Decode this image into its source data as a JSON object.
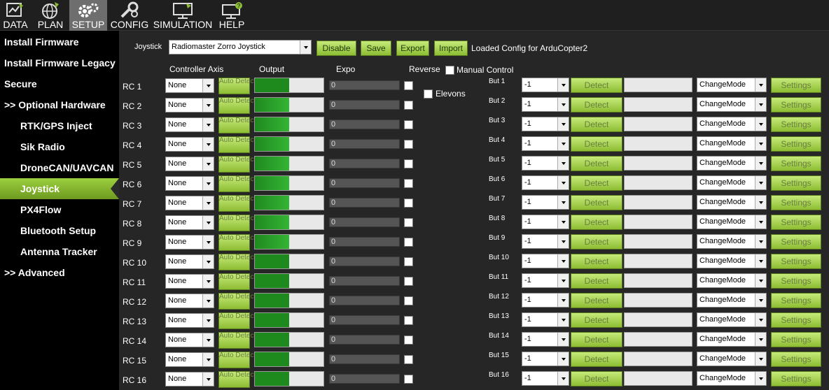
{
  "menu": [
    {
      "label": "DATA",
      "icon": "data-icon"
    },
    {
      "label": "PLAN",
      "icon": "plan-icon"
    },
    {
      "label": "SETUP",
      "icon": "setup-icon",
      "active": true
    },
    {
      "label": "CONFIG",
      "icon": "config-icon"
    },
    {
      "label": "SIMULATION",
      "icon": "simulation-icon"
    },
    {
      "label": "HELP",
      "icon": "help-icon"
    }
  ],
  "sidebar": [
    {
      "label": "Install Firmware",
      "level": "top"
    },
    {
      "label": "Install Firmware Legacy",
      "level": "top"
    },
    {
      "label": "Secure",
      "level": "top"
    },
    {
      "label": ">> Optional Hardware",
      "level": "top"
    },
    {
      "label": "RTK/GPS Inject",
      "level": "sub"
    },
    {
      "label": "Sik Radio",
      "level": "sub"
    },
    {
      "label": "DroneCAN/UAVCAN",
      "level": "sub"
    },
    {
      "label": "Joystick",
      "level": "sub",
      "active": true
    },
    {
      "label": "PX4Flow",
      "level": "sub"
    },
    {
      "label": "Bluetooth Setup",
      "level": "sub"
    },
    {
      "label": "Antenna Tracker",
      "level": "sub"
    },
    {
      "label": ">> Advanced",
      "level": "top"
    }
  ],
  "joystick": {
    "label": "Joystick",
    "device": "Radiomaster Zorro Joystick",
    "disable": "Disable",
    "save": "Save",
    "export": "Export",
    "import": "Import",
    "status": "Loaded Config for ArduCopter2"
  },
  "headers": {
    "axis": "Controller Axis",
    "output": "Output",
    "expo": "Expo",
    "reverse": "Reverse",
    "manual": "Manual Control",
    "elevons": "Elevons"
  },
  "auto_detect": "Auto Detect",
  "channels": [
    {
      "label": "RC 1",
      "axis": "None",
      "output": 0.5,
      "expo": "0"
    },
    {
      "label": "RC 2",
      "axis": "None",
      "output": 0.5,
      "expo": "0"
    },
    {
      "label": "RC 3",
      "axis": "None",
      "output": 0.5,
      "expo": "0"
    },
    {
      "label": "RC 4",
      "axis": "None",
      "output": 0.5,
      "expo": "0"
    },
    {
      "label": "RC 5",
      "axis": "None",
      "output": 0.5,
      "expo": "0"
    },
    {
      "label": "RC 6",
      "axis": "None",
      "output": 0.5,
      "expo": "0"
    },
    {
      "label": "RC 7",
      "axis": "None",
      "output": 0.5,
      "expo": "0"
    },
    {
      "label": "RC 8",
      "axis": "None",
      "output": 0.5,
      "expo": "0"
    },
    {
      "label": "RC 9",
      "axis": "None",
      "output": 0.5,
      "expo": "0"
    },
    {
      "label": "RC 10",
      "axis": "None",
      "output": 0.5,
      "expo": "0"
    },
    {
      "label": "RC 11",
      "axis": "None",
      "output": 0.5,
      "expo": "0"
    },
    {
      "label": "RC 12",
      "axis": "None",
      "output": 0.5,
      "expo": "0"
    },
    {
      "label": "RC 13",
      "axis": "None",
      "output": 0.5,
      "expo": "0"
    },
    {
      "label": "RC 14",
      "axis": "None",
      "output": 0.5,
      "expo": "0"
    },
    {
      "label": "RC 15",
      "axis": "None",
      "output": 0.5,
      "expo": "0"
    },
    {
      "label": "RC 16",
      "axis": "None",
      "output": 0.5,
      "expo": "0"
    }
  ],
  "buttons_common": {
    "detect": "Detect",
    "settings": "Settings"
  },
  "buttons": [
    {
      "label": "But 1",
      "value": "-1",
      "action": "ChangeMode"
    },
    {
      "label": "But 2",
      "value": "-1",
      "action": "ChangeMode"
    },
    {
      "label": "But 3",
      "value": "-1",
      "action": "ChangeMode"
    },
    {
      "label": "But 4",
      "value": "-1",
      "action": "ChangeMode"
    },
    {
      "label": "But 5",
      "value": "-1",
      "action": "ChangeMode"
    },
    {
      "label": "But 6",
      "value": "-1",
      "action": "ChangeMode"
    },
    {
      "label": "But 7",
      "value": "-1",
      "action": "ChangeMode"
    },
    {
      "label": "But 8",
      "value": "-1",
      "action": "ChangeMode"
    },
    {
      "label": "But 9",
      "value": "-1",
      "action": "ChangeMode"
    },
    {
      "label": "But 10",
      "value": "-1",
      "action": "ChangeMode"
    },
    {
      "label": "But 11",
      "value": "-1",
      "action": "ChangeMode"
    },
    {
      "label": "But 12",
      "value": "-1",
      "action": "ChangeMode"
    },
    {
      "label": "But 13",
      "value": "-1",
      "action": "ChangeMode"
    },
    {
      "label": "But 14",
      "value": "-1",
      "action": "ChangeMode"
    },
    {
      "label": "But 15",
      "value": "-1",
      "action": "ChangeMode"
    },
    {
      "label": "But 16",
      "value": "-1",
      "action": "ChangeMode"
    }
  ],
  "colors": {
    "accent": "#8dbd33",
    "output_fill": "#1e8a1e",
    "sidebar_active": "#8bbf2f"
  }
}
